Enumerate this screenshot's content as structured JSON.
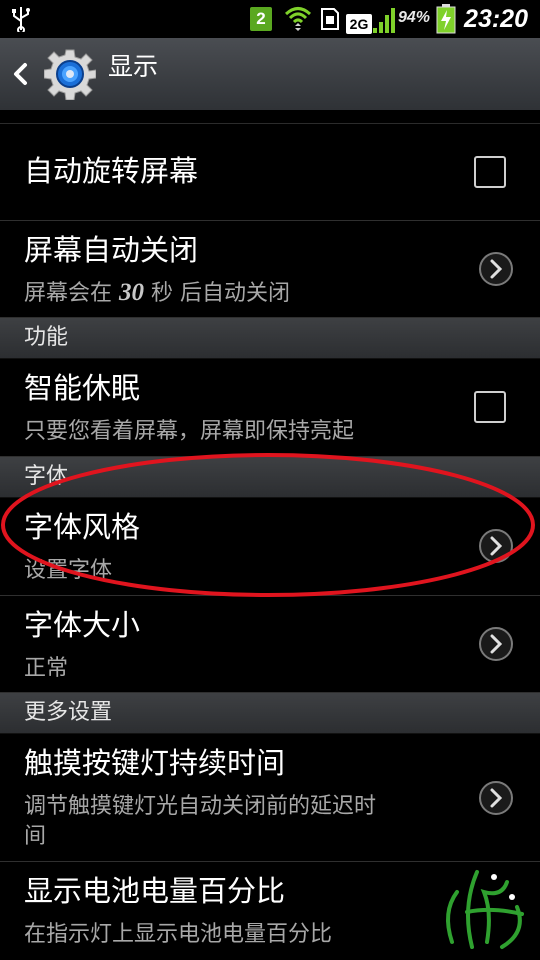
{
  "status_bar": {
    "sim_label": "2",
    "network_label": "2G",
    "battery_percent": "94%",
    "time": "23:20"
  },
  "header": {
    "back_icon": "back-chevron-icon",
    "app_icon": "gear-icon",
    "title": "显示"
  },
  "items": {
    "auto_rotate": {
      "title": "自动旋转屏幕",
      "checked": false
    },
    "screen_timeout": {
      "title": "屏幕自动关闭",
      "sub_before": "屏幕会在",
      "sub_number": "30",
      "sub_after": "秒 后自动关闭"
    },
    "smart_stay": {
      "title": "智能休眠",
      "sub": "只要您看着屏幕，屏幕即保持亮起",
      "checked": false
    },
    "font_style": {
      "title": "字体风格",
      "sub": "设置字体"
    },
    "font_size": {
      "title": "字体大小",
      "sub": "正常"
    },
    "touch_key_light": {
      "title": "触摸按键灯持续时间",
      "sub_line1": "调节触摸键灯光自动关闭前的延迟时",
      "sub_line2": "间"
    },
    "battery_percentage": {
      "title": "显示电池电量百分比",
      "sub": "在指示灯上显示电池电量百分比"
    }
  },
  "sections": {
    "function": "功能",
    "font": "字体",
    "more": "更多设置"
  },
  "colors": {
    "annotation_ellipse": "#e0141e",
    "wifi_green": "#7fd12a",
    "chevron_circle": "#7a7a7a"
  }
}
